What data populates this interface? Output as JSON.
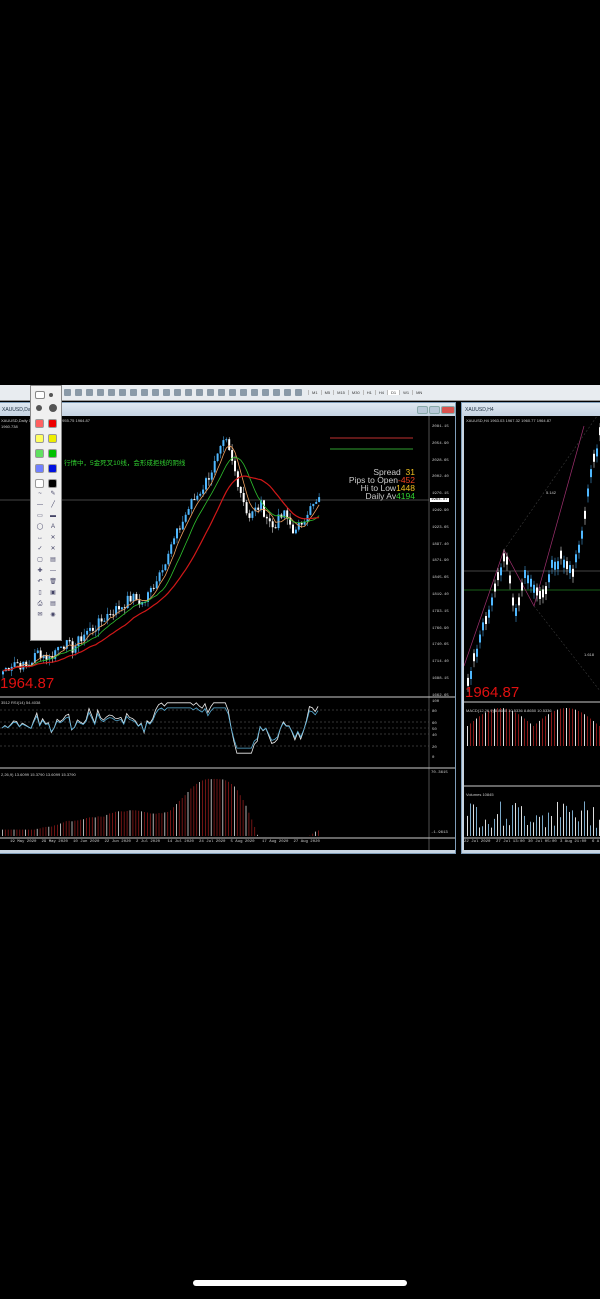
{
  "toolbar": {
    "timeframes": [
      "M1",
      "M5",
      "M15",
      "M30",
      "H1",
      "H4",
      "D1",
      "W1",
      "MN"
    ]
  },
  "left_window": {
    "title": "XAUUSD,Daily",
    "header": "XAUUSD,Daily 1964.87 1973.45 1955.75 1964.87",
    "subheader": "1960.738",
    "annotation": "行情中，5金死叉10线，会形成拒线的阴线",
    "big_price": "1964.87",
    "price_axis": [
      "2081.15",
      "2054.90",
      "2028.65",
      "2002.40",
      "1976.15",
      "1949.90",
      "1923.65",
      "1897.40",
      "1871.90",
      "1845.65",
      "1819.40",
      "1793.15",
      "1766.90",
      "1740.65",
      "1714.40",
      "1688.15",
      "1662.65"
    ],
    "current_price": "1964.87",
    "info": {
      "spread_label": "Spread",
      "spread": "31",
      "pips_label": "Pips to Open",
      "pips": "-452",
      "hilo_label": "Hi to Low",
      "hilo": "1448",
      "daily_label": "Daily Av",
      "daily": "4194"
    },
    "rsi": {
      "label": "3512 RSI(14) 54.4038",
      "levels": [
        "100",
        "80",
        "60",
        "50",
        "40",
        "20",
        "0"
      ]
    },
    "macd": {
      "label": "2,26,9) 13.6099 15.3790 13.6099 15.3790",
      "max": "70.3615",
      "min": "-1.9613"
    },
    "dates": [
      "19 May 2020",
      "29 May 2020",
      "10 Jun 2020",
      "22 Jun 2020",
      "2 Jul 2020",
      "14 Jul 2020",
      "24 Jul 2020",
      "5 Aug 2020",
      "17 Aug 2020",
      "27 Aug 2020"
    ],
    "price_path": [
      1700,
      1715,
      1705,
      1730,
      1720,
      1745,
      1735,
      1760,
      1770,
      1790,
      1800,
      1815,
      1805,
      1840,
      1880,
      1920,
      1960,
      1985,
      2020,
      2060,
      2000,
      1940,
      1960,
      1925,
      1945,
      1915,
      1950,
      1965
    ]
  },
  "right_window": {
    "title": "XAUUSD,H4",
    "header": "XAUUSD,H4 1963.03 1967.32 1960.77 1964.87",
    "fib_high": "5.142",
    "fib_low": "1.618",
    "big_price": "1964.87",
    "macd_label": "MACD(12,26,9) 8.8650 10.5336 8.8650 10.5336",
    "volumes_label": "Volumes 10845",
    "dates": [
      "22 Jul 2020",
      "27 Jul 13:00",
      "30 Jul 05:00",
      "3 Aug 21:00",
      "6 A"
    ]
  },
  "colors": {
    "bull": "#4fb8ff",
    "bear": "#ffffff",
    "ma_fast": "#f0a060",
    "ma_mid": "#2ec02e",
    "ma_slow": "#d01818",
    "macd": "#8b1a1a",
    "accent_red": "#e01010"
  }
}
